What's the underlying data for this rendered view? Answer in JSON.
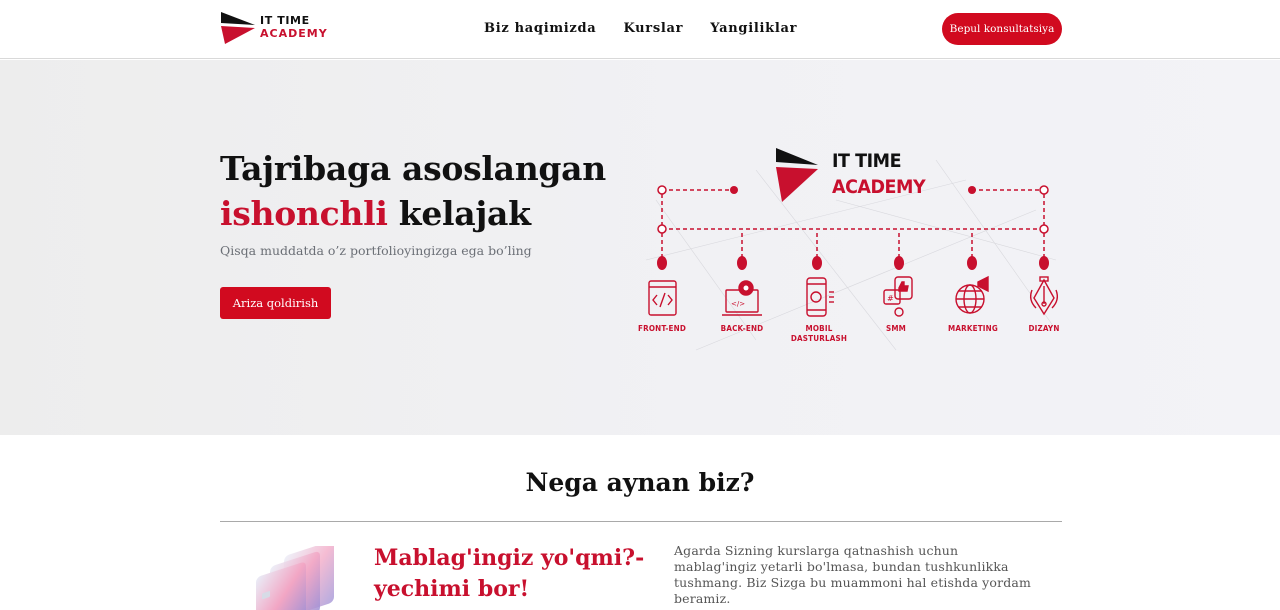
{
  "header": {
    "logo_line1": "IT TIME",
    "logo_line2": "ACADEMY",
    "nav": [
      "Biz haqimizda",
      "Kurslar",
      "Yangiliklar"
    ],
    "cta_label": "Bepul konsultatsiya"
  },
  "hero": {
    "title_line1": "Tajribaga asoslangan",
    "title_accent": "ishonchli",
    "title_rest": " kelajak",
    "subtitle": "Qisqa muddatda o’z portfolioyingizga ega bo’ling",
    "button_label": "Ariza qoldirish",
    "diagram": {
      "brand_line1": "IT TIME",
      "brand_line2": "ACADEMY",
      "directions": [
        {
          "label": "FRONT-END",
          "icon": "code-window-icon"
        },
        {
          "label": "BACK-END",
          "icon": "gear-laptop-icon"
        },
        {
          "label": "MOBIL DASTURLASH",
          "icon": "smartphone-icon"
        },
        {
          "label": "SMM",
          "icon": "social-like-icon"
        },
        {
          "label": "MARKETING",
          "icon": "globe-megaphone-icon"
        },
        {
          "label": "DIZAYN",
          "icon": "pen-tool-icon"
        }
      ]
    }
  },
  "why": {
    "title": "Nega aynan biz?",
    "feature_title_line1": "Mablag'ingiz yo'qmi?-",
    "feature_title_line2": "yechimi bor!",
    "feature_text": "Agarda Sizning kurslarga qatnashish uchun mablag'ingiz yetarli bo'lmasa, bundan tushkunlikka tushmang. Biz Sizga bu muammoni hal etishda yordam beramiz."
  },
  "colors": {
    "brand_red": "#d10a1f",
    "accent_red": "#c8102e",
    "text_dark": "#111111",
    "muted": "#6b6f76"
  }
}
